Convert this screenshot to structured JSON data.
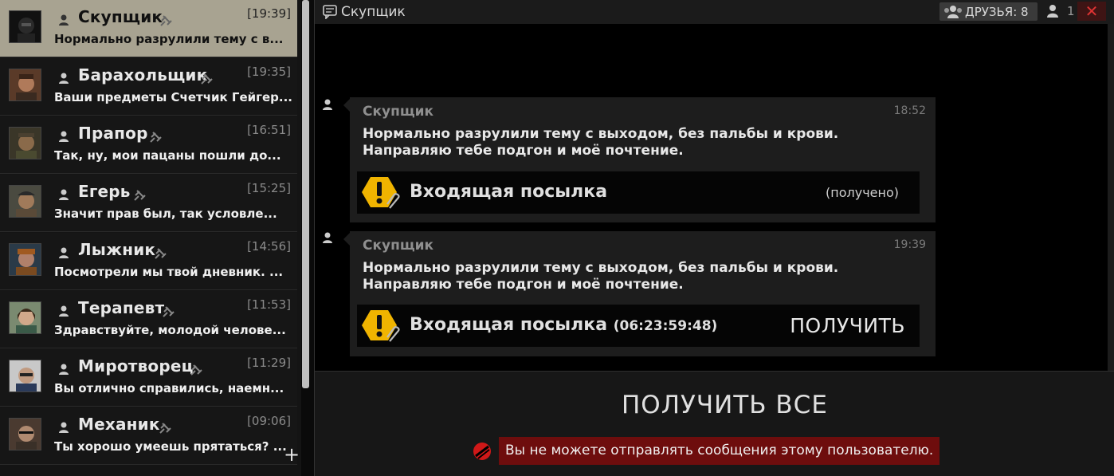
{
  "sidebar": {
    "dialogs": [
      {
        "name": "Скупщик",
        "time": "[19:39]",
        "preview": "Нормально разрулили тему с в...",
        "active": true
      },
      {
        "name": "Барахольщик",
        "time": "[19:35]",
        "preview": "Ваши предметы Счетчик Гейгер...",
        "active": false
      },
      {
        "name": "Прапор",
        "time": "[16:51]",
        "preview": "Так, ну, мои пацаны пошли до...",
        "active": false
      },
      {
        "name": "Егерь",
        "time": "[15:25]",
        "preview": "Значит прав был, так условле...",
        "active": false
      },
      {
        "name": "Лыжник",
        "time": "[14:56]",
        "preview": "Посмотрели мы твой дневник. ...",
        "active": false
      },
      {
        "name": "Терапевт",
        "time": "[11:53]",
        "preview": "Здравствуйте, молодой челове...",
        "active": false
      },
      {
        "name": "Миротворец",
        "time": "[11:29]",
        "preview": "Вы отлично справились, наемн...",
        "active": false
      },
      {
        "name": "Механик",
        "time": "[09:06]",
        "preview": "Ты хорошо умеешь прятаться? ...",
        "active": false
      }
    ],
    "add_label": "+"
  },
  "header": {
    "title": "Скупщик",
    "friends_label": "ДРУЗЬЯ: 8",
    "online_count": "1",
    "close_label": "✕"
  },
  "messages": [
    {
      "sender": "Скупщик",
      "time": "18:52",
      "line1": "Нормально разрулили тему с выходом, без пальбы и крови.",
      "line2": "Направляю тебе подгон и моё почтение.",
      "parcel_title": "Входящая посылка",
      "parcel_status": "(получено)"
    },
    {
      "sender": "Скупщик",
      "time": "19:39",
      "line1": "Нормально разрулили тему с выходом, без пальбы и крови.",
      "line2": "Направляю тебе подгон и моё почтение.",
      "parcel_title": "Входящая посылка",
      "parcel_timer": "(06:23:59:48)",
      "parcel_action": "ПОЛУЧИТЬ"
    }
  ],
  "footer": {
    "get_all_label": "ПОЛУЧИТЬ ВСЕ",
    "blocked_text": "Вы не можете отправлять сообщения этому пользователю."
  },
  "colors": {
    "active_dialog": "#a8a391",
    "blocked_bg": "#6e0d0d",
    "close_accent": "#dd3333",
    "warning": "#f0b400"
  },
  "icons": [
    "user-icon",
    "pin-icon",
    "chat-bubble-icon",
    "friends-icon",
    "close-icon",
    "warning-icon",
    "paperclip-icon",
    "blocked-icon",
    "plus-icon"
  ]
}
